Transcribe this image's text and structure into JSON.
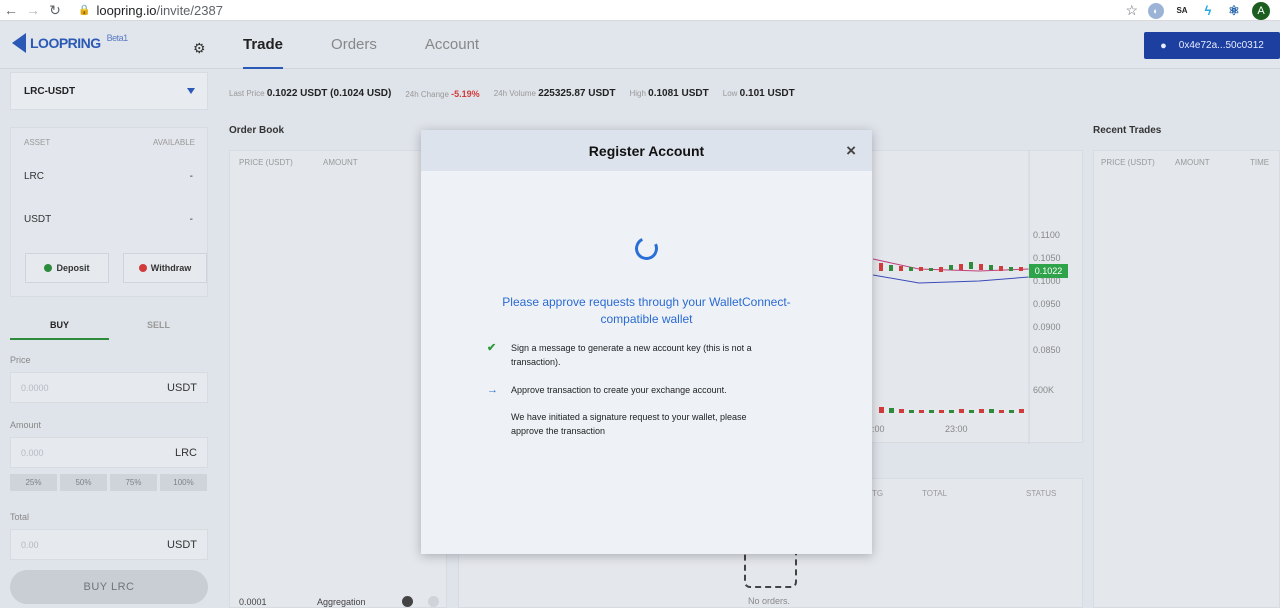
{
  "browser": {
    "url_domain": "loopring.io",
    "url_path": "/invite/2387",
    "ext_sa": "SA",
    "avatar_letter": "A"
  },
  "header": {
    "logo_text": "LOOPRING",
    "logo_beta": "Beta1",
    "tabs": [
      {
        "label": "Trade",
        "active": true
      },
      {
        "label": "Orders",
        "active": false
      },
      {
        "label": "Account",
        "active": false
      }
    ],
    "wallet_address": "0x4e72a...50c0312"
  },
  "sidebar": {
    "pair": "LRC-USDT",
    "asset_col": "ASSET",
    "available_col": "AVAILABLE",
    "assets": [
      {
        "name": "LRC",
        "available": "-"
      },
      {
        "name": "USDT",
        "available": "-"
      }
    ],
    "deposit_label": "Deposit",
    "withdraw_label": "Withdraw",
    "buy_tab": "BUY",
    "sell_tab": "SELL",
    "price_label": "Price",
    "price_placeholder": "0.0000",
    "price_unit": "USDT",
    "amount_label": "Amount",
    "amount_placeholder": "0.000",
    "amount_unit": "LRC",
    "percents": [
      "25%",
      "50%",
      "75%",
      "100%"
    ],
    "total_label": "Total",
    "total_placeholder": "0.00",
    "total_unit": "USDT",
    "buy_button": "BUY  LRC"
  },
  "ticker": {
    "last_price_label": "Last Price",
    "last_price": "0.1022 USDT (0.1024 USD)",
    "change_label": "24h Change",
    "change": "-5.19%",
    "volume_label": "24h Volume",
    "volume": "225325.87 USDT",
    "high_label": "High",
    "high": "0.1081 USDT",
    "low_label": "Low",
    "low": "0.101 USDT"
  },
  "order_book": {
    "title": "Order Book",
    "price_col": "PRICE (USDT)",
    "amount_col": "AMOUNT",
    "precision": "0.0001",
    "aggregation": "Aggregation"
  },
  "chart": {
    "ticks": [
      "0.1100",
      "0.1050",
      "0.1000",
      "0.0950",
      "0.0900",
      "0.0850"
    ],
    "current": "0.1022",
    "volume_tick": "600K",
    "time_labels": [
      ":00",
      "23:00"
    ]
  },
  "orders_panel": {
    "cols": [
      "TG",
      "TOTAL",
      "STATUS"
    ],
    "empty": "No orders."
  },
  "recent_trades": {
    "title": "Recent Trades",
    "price_col": "PRICE (USDT)",
    "amount_col": "AMOUNT",
    "time_col": "TIME"
  },
  "modal": {
    "title": "Register Account",
    "close": "×",
    "approve_text": "Please approve requests through your WalletConnect-compatible wallet",
    "step1": "Sign a message to generate a new account key (this is not a transaction).",
    "step2": "Approve transaction to create your exchange account.",
    "step2_note": "We have initiated a signature request to your wallet, please approve the transaction"
  },
  "colors": {
    "accent": "#2a5ab5",
    "buy": "#2e8b3c",
    "sell": "#d23b3b"
  }
}
